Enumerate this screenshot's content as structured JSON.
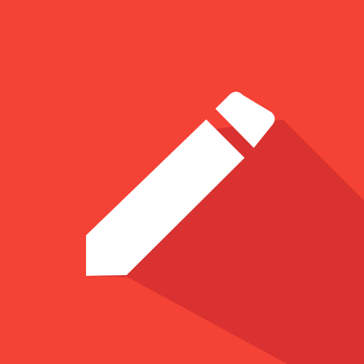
{
  "icon": {
    "name": "pencil-icon",
    "background_color": "#F44336",
    "shadow_color": "#D32F2F",
    "glyph_color": "#FFFFFF"
  }
}
